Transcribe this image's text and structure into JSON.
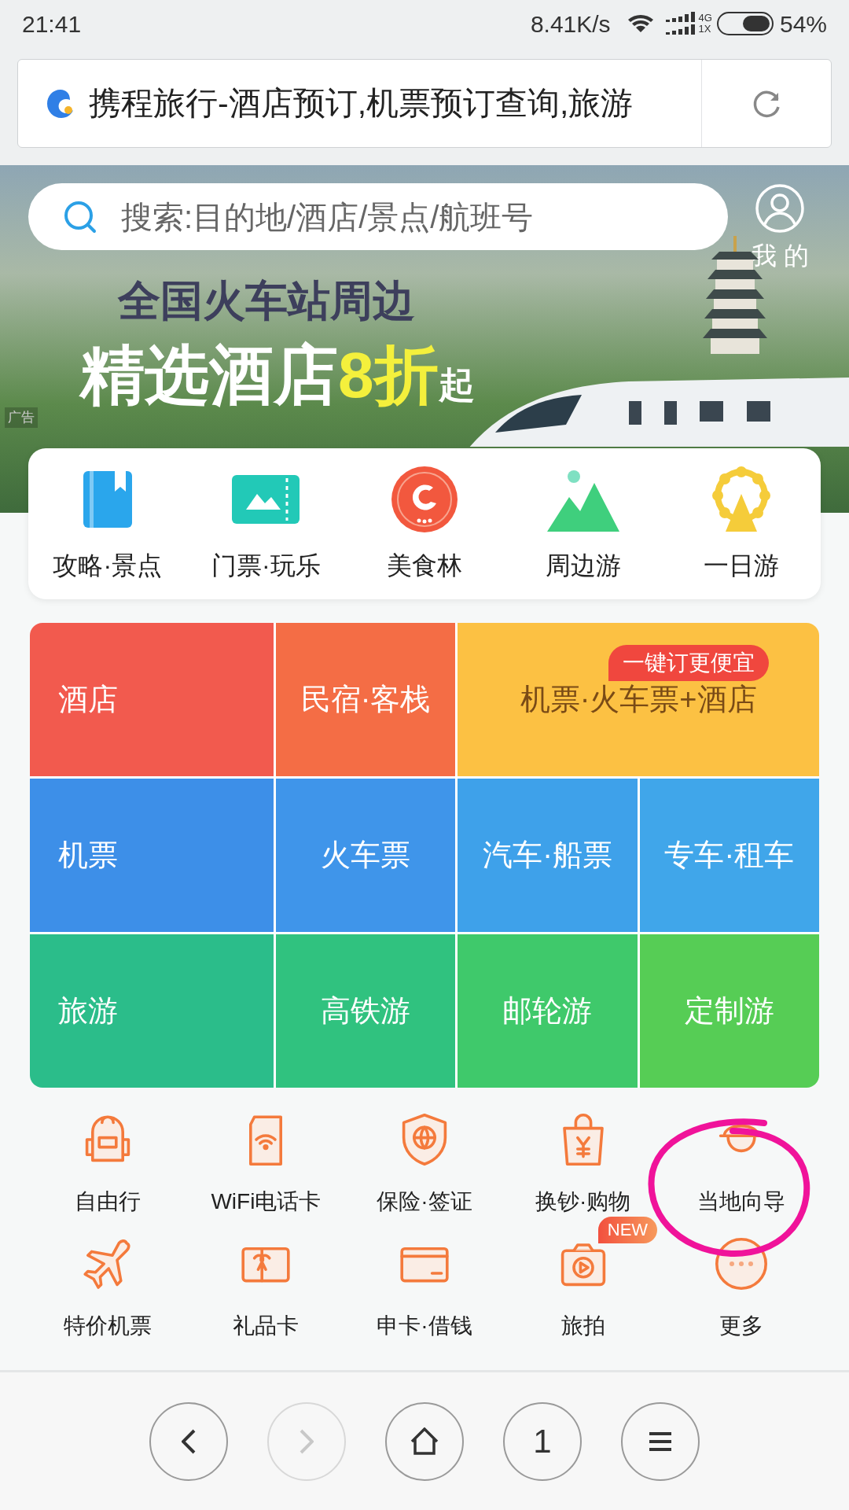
{
  "status_bar": {
    "time": "21:41",
    "speed": "8.41K/s",
    "network_top": "4G",
    "network_bottom": "1X",
    "battery": "54%"
  },
  "address_bar": {
    "title": "携程旅行-酒店预订,机票预订查询,旅游"
  },
  "search": {
    "placeholder": "搜索:目的地/酒店/景点/航班号",
    "profile_label": "我 的"
  },
  "banner": {
    "headline": "全国火车站周边",
    "tagline": "精选酒店",
    "highlight": "8折",
    "suffix": "起",
    "ad_label": "广告"
  },
  "quick_links": [
    {
      "kind": "book",
      "label": "攻略·景点"
    },
    {
      "kind": "ticket",
      "label": "门票·玩乐"
    },
    {
      "kind": "logo",
      "label": "美食林"
    },
    {
      "kind": "mountain",
      "label": "周边游"
    },
    {
      "kind": "wheel",
      "label": "一日游"
    }
  ],
  "main_grid": [
    [
      {
        "label": "酒店",
        "color": "#f25a4e"
      },
      {
        "label": "民宿·客栈",
        "color": "#f46d45"
      },
      {
        "label": "机票·火车票+酒店",
        "color": "#fcc143",
        "badge": "一键订更便宜"
      }
    ],
    [
      {
        "label": "机票",
        "color": "#3d8fe8"
      },
      {
        "label": "火车票",
        "color": "#3f95ea"
      },
      {
        "label": "汽车·船票",
        "color": "#3ea1ea"
      },
      {
        "label": "专车·租车",
        "color": "#40a6ea"
      }
    ],
    [
      {
        "label": "旅游",
        "color": "#2bbd8a"
      },
      {
        "label": "高铁游",
        "color": "#30c27f"
      },
      {
        "label": "邮轮游",
        "color": "#3fc96b"
      },
      {
        "label": "定制游",
        "color": "#56cd55"
      }
    ]
  ],
  "services": [
    {
      "kind": "backpack",
      "label": "自由行"
    },
    {
      "kind": "sim",
      "label": "WiFi电话卡"
    },
    {
      "kind": "shield",
      "label": "保险·签证"
    },
    {
      "kind": "bag",
      "label": "换钞·购物"
    },
    {
      "kind": "guide",
      "label": "当地向导"
    },
    {
      "kind": "plane",
      "label": "特价机票"
    },
    {
      "kind": "gift",
      "label": "礼品卡"
    },
    {
      "kind": "card",
      "label": "申卡·借钱"
    },
    {
      "kind": "camera",
      "label": "旅拍",
      "badge": "NEW"
    },
    {
      "kind": "more",
      "label": "更多"
    }
  ],
  "nav": [
    {
      "kind": "back",
      "disabled": false
    },
    {
      "kind": "forward",
      "disabled": true
    },
    {
      "kind": "home",
      "disabled": false
    },
    {
      "kind": "tabs",
      "label": "1",
      "disabled": false
    },
    {
      "kind": "menu",
      "disabled": false
    }
  ]
}
